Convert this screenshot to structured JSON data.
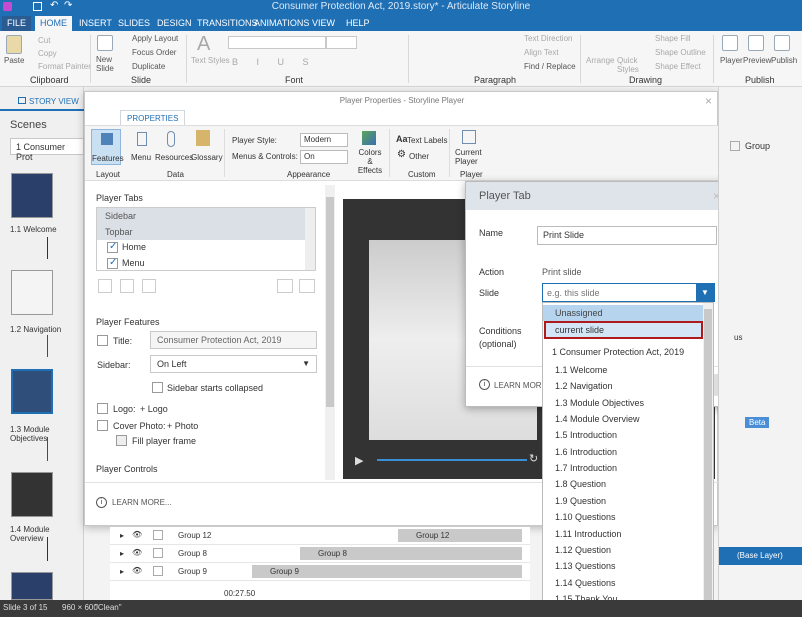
{
  "app": {
    "title": "Consumer Protection Act, 2019.story* - Articulate Storyline"
  },
  "ribbon_tabs": [
    "FILE",
    "HOME",
    "INSERT",
    "SLIDES",
    "DESIGN",
    "TRANSITIONS",
    "ANIMATIONS",
    "VIEW",
    "HELP"
  ],
  "ribbon": {
    "paste": "Paste",
    "cut": "Cut",
    "copy": "Copy",
    "format_painter": "Format Painter",
    "clipboard": "Clipboard",
    "new_slide": "New Slide",
    "apply_layout": "Apply Layout",
    "focus_order": "Focus Order",
    "duplicate": "Duplicate",
    "slide_group": "Slide",
    "text_styles": "Text Styles",
    "font_group": "Font",
    "text_direction": "Text Direction",
    "align_text": "Align Text",
    "find_replace": "Find / Replace",
    "paragraph_group": "Paragraph",
    "arrange": "Arrange",
    "quick_styles": "Quick Styles",
    "shape_fill": "Shape Fill",
    "shape_outline": "Shape Outline",
    "shape_effect": "Shape Effect",
    "drawing_group": "Drawing",
    "player": "Player",
    "preview": "Preview",
    "publish": "Publish",
    "publish_group": "Publish"
  },
  "left": {
    "story_view": "STORY VIEW",
    "scenes": "Scenes",
    "scene_select": "1 Consumer Prot",
    "slides": [
      "1.1 Welcome",
      "1.2 Navigation",
      "1.3 Module Objectives",
      "1.4 Module Overview"
    ]
  },
  "dialog": {
    "title": "Player Properties - Storyline Player",
    "properties_tab": "PROPERTIES",
    "toolbar": {
      "features": "Features",
      "menu": "Menu",
      "resources": "Resources",
      "glossary": "Glossary",
      "layout_group": "Layout",
      "data_group": "Data",
      "player_style_label": "Player Style:",
      "player_style_value": "Modern",
      "menus_controls_label": "Menus & Controls:",
      "menus_controls_value": "On",
      "colors_effects": "Colors & Effects",
      "appearance_group": "Appearance",
      "text_labels": "Text Labels",
      "other": "Other",
      "custom_group": "Custom",
      "current_player": "Current Player",
      "player_group": "Player"
    },
    "player_tabs_heading": "Player Tabs",
    "player_tabs": [
      "Sidebar",
      "Topbar",
      "Home",
      "Menu"
    ],
    "player_features_heading": "Player Features",
    "title_label": "Title:",
    "title_value": "Consumer Protection Act, 2019",
    "sidebar_label": "Sidebar:",
    "sidebar_value": "On Left",
    "sidebar_collapsed": "Sidebar starts collapsed",
    "logo_label": "Logo:",
    "logo_add": "+ Logo",
    "cover_label": "Cover Photo:",
    "cover_add": "+ Photo",
    "fill_frame": "Fill player frame",
    "player_controls_heading": "Player Controls",
    "learn_more": "LEARN MORE..."
  },
  "player_tab": {
    "heading": "Player Tab",
    "name_label": "Name",
    "name_value": "Print Slide",
    "action_label": "Action",
    "action_value": "Print slide",
    "slide_label": "Slide",
    "slide_placeholder": "e.g. this slide",
    "conditions_label": "Conditions",
    "optional": "(optional)",
    "learn_more": "LEARN MORE"
  },
  "dropdown": {
    "items": [
      "Unassigned",
      "current slide",
      "1 Consumer Protection Act, 2019",
      "1.1 Welcome",
      "1.2 Navigation",
      "1.3 Module Objectives",
      "1.4 Module Overview",
      "1.5 Introduction",
      "1.6 Introduction",
      "1.7 Introduction",
      "1.8 Question",
      "1.9 Question",
      "1.10 Questions",
      "1.11 Introduction",
      "1.12 Question",
      "1.13 Questions",
      "1.14 Questions",
      "1.15 Thank You"
    ]
  },
  "timeline": {
    "rows": [
      "Group 12",
      "Group 8",
      "Group 9"
    ],
    "time": "00:27.50"
  },
  "right": {
    "group": "Group",
    "beta": "Beta",
    "base_layer": "(Base Layer)",
    "us_text": "us"
  },
  "status": {
    "slide": "Slide 3 of 15",
    "size": "960 × 600",
    "theme": "\"Clean\""
  },
  "colors": {
    "accent": "#1f6fb5",
    "highlight_border": "#b01a1a"
  }
}
